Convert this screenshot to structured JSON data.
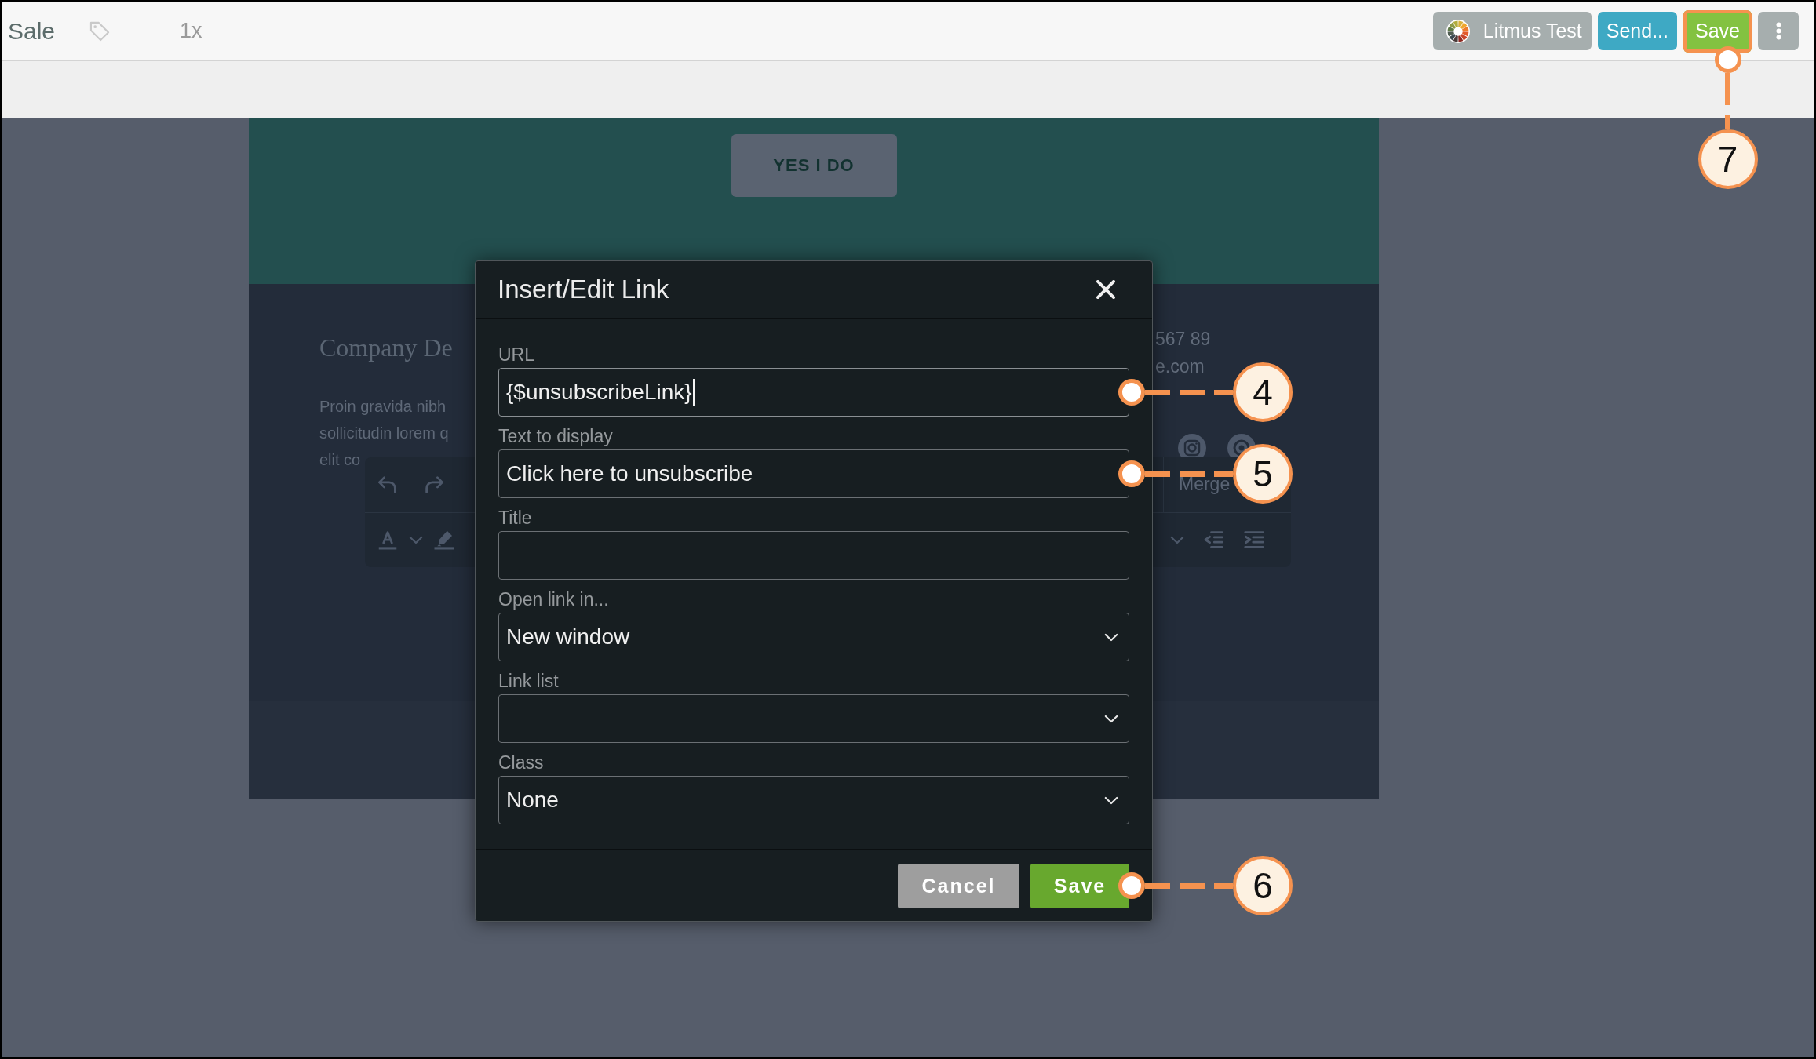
{
  "top_bar": {
    "title": "Sale",
    "zoom": "1x",
    "buttons": [
      {
        "kind": "litmus",
        "label": "Litmus Test",
        "highlighted": false
      },
      {
        "kind": "send",
        "label": "Send...",
        "highlighted": false
      },
      {
        "kind": "save",
        "label": "Save",
        "highlighted": true,
        "callout": "7"
      },
      {
        "kind": "more",
        "highlighted": false
      }
    ]
  },
  "email": {
    "button": "YES I DO",
    "heading": "Company De",
    "paragraph_lines": [
      "Proin gravida nibh",
      "sollicitudin lorem q",
      "elit co"
    ],
    "contact_lines": [
      "567 89",
      "e.com"
    ],
    "toolbar": {
      "merge": "Merge"
    }
  },
  "dialog": {
    "title": "Insert/Edit Link",
    "fields": [
      {
        "kind": "text",
        "label": "URL",
        "value": "{$unsubscribeLink}",
        "focused": true,
        "callout": "4"
      },
      {
        "kind": "text",
        "label": "Text to display",
        "value": "Click here to unsubscribe",
        "focused": false,
        "callout": "5"
      },
      {
        "kind": "text",
        "label": "Title",
        "focused": false
      },
      {
        "kind": "select",
        "label": "Open link in...",
        "value": "New window",
        "focused": false
      },
      {
        "kind": "select",
        "label": "Link list",
        "focused": false
      },
      {
        "kind": "select",
        "label": "Class",
        "value": "None",
        "focused": false
      }
    ],
    "buttons": [
      {
        "kind": "cancel",
        "label": "Cancel"
      },
      {
        "kind": "save",
        "label": "Save",
        "callout": "6"
      }
    ]
  }
}
